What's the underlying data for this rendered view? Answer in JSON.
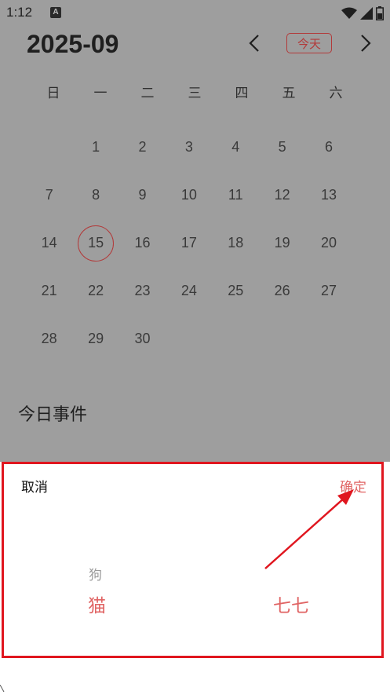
{
  "status_bar": {
    "time": "1:12",
    "notification_icon_letter": "A",
    "icons": [
      "wifi-icon",
      "signal-icon",
      "battery-icon"
    ]
  },
  "calendar": {
    "month_title": "2025-09",
    "today_label": "今天",
    "prev_icon": "chevron-left-icon",
    "next_icon": "chevron-right-icon",
    "weekdays": [
      "日",
      "一",
      "二",
      "三",
      "四",
      "五",
      "六"
    ],
    "leading_blanks": 1,
    "days": [
      "1",
      "2",
      "3",
      "4",
      "5",
      "6",
      "7",
      "8",
      "9",
      "10",
      "11",
      "12",
      "13",
      "14",
      "15",
      "16",
      "17",
      "18",
      "19",
      "20",
      "21",
      "22",
      "23",
      "24",
      "25",
      "26",
      "27",
      "28",
      "29",
      "30"
    ],
    "selected_day": "15"
  },
  "events": {
    "title": "今日事件"
  },
  "picker": {
    "cancel_label": "取消",
    "confirm_label": "确定",
    "left_wheel_above": "狗",
    "left_wheel_selected": "猫",
    "right_wheel_selected": "七七"
  },
  "colors": {
    "accent": "#e06464",
    "dark_accent": "#b23a3a",
    "highlight_box": "#e0161f",
    "dim_overlay": "#9e9e9e"
  }
}
